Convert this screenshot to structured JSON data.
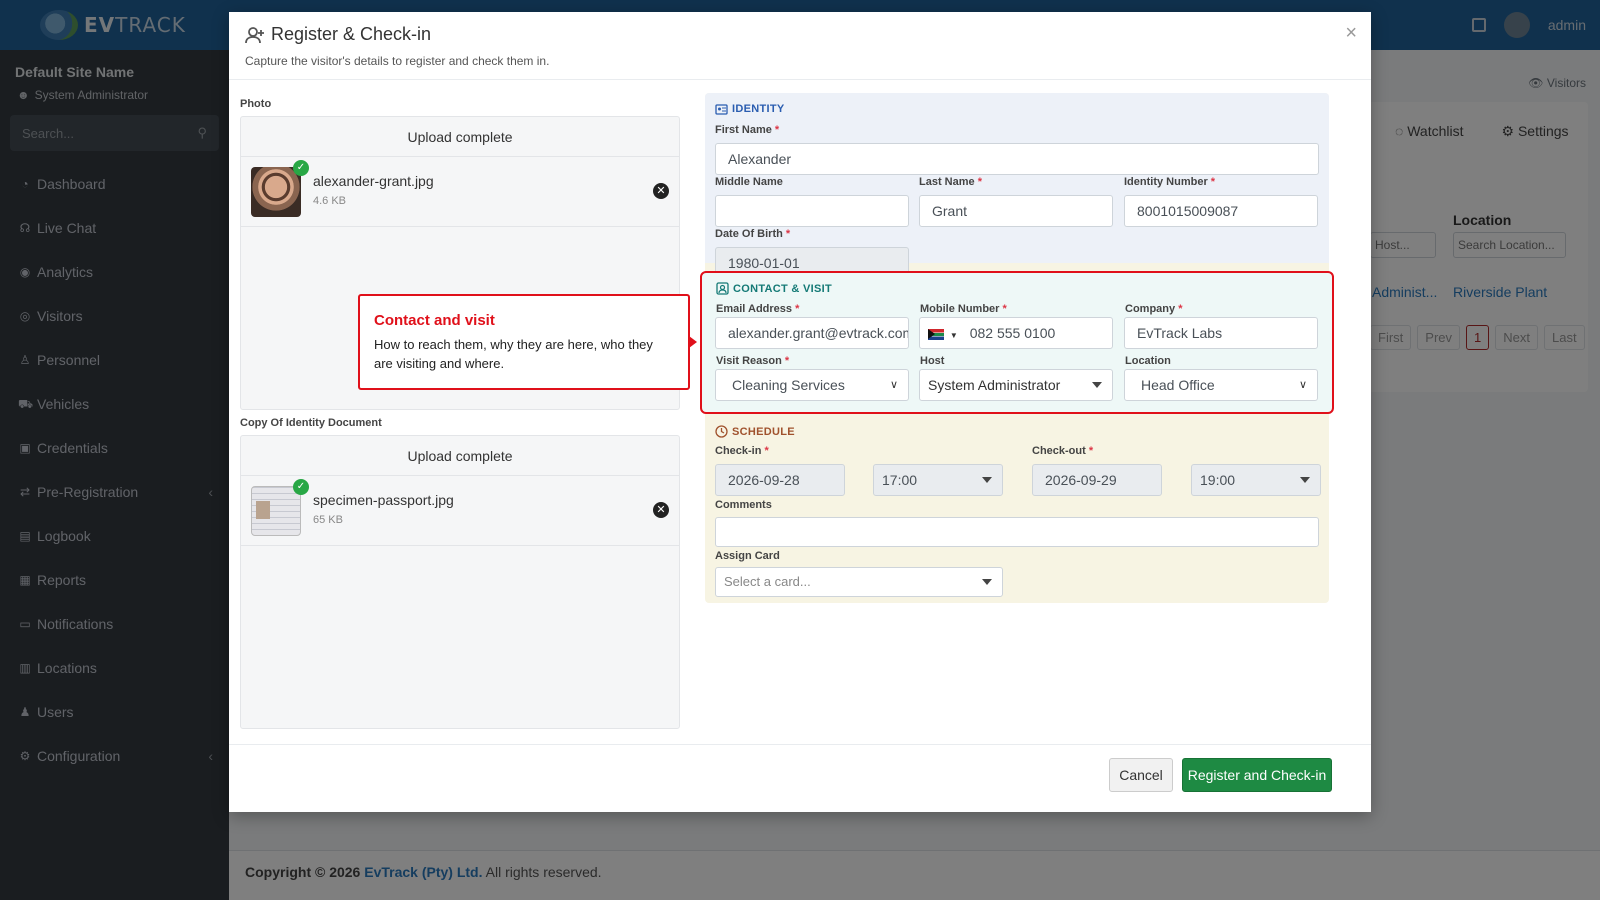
{
  "brand": {
    "name_bold": "EV",
    "name_rest": "TRACK"
  },
  "topbar": {
    "user": "admin"
  },
  "sidebar": {
    "site": "Default Site Name",
    "role": "System Administrator",
    "search_placeholder": "Search...",
    "items": [
      {
        "label": "Dashboard",
        "icon": "dashboard-icon"
      },
      {
        "label": "Live Chat",
        "icon": "headset-icon"
      },
      {
        "label": "Analytics",
        "icon": "analytics-icon"
      },
      {
        "label": "Visitors",
        "icon": "eye-icon"
      },
      {
        "label": "Personnel",
        "icon": "personnel-icon"
      },
      {
        "label": "Vehicles",
        "icon": "car-icon"
      },
      {
        "label": "Credentials",
        "icon": "id-card-icon"
      },
      {
        "label": "Pre-Registration",
        "icon": "exchange-icon",
        "has_submenu": true
      },
      {
        "label": "Logbook",
        "icon": "book-icon"
      },
      {
        "label": "Reports",
        "icon": "reports-icon"
      },
      {
        "label": "Notifications",
        "icon": "bell-icon"
      },
      {
        "label": "Locations",
        "icon": "building-icon"
      },
      {
        "label": "Users",
        "icon": "users-icon"
      },
      {
        "label": "Configuration",
        "icon": "gear-icon",
        "has_submenu": true
      }
    ]
  },
  "background": {
    "breadcrumb": "Visitors",
    "tabs": [
      "Watchlist",
      "Settings"
    ],
    "location_header": "Location",
    "host_placeholder": "Host...",
    "location_placeholder": "Search Location...",
    "row_host": "Administ...",
    "row_location": "Riverside Plant",
    "pager": [
      "First",
      "Prev",
      "1",
      "Next",
      "Last"
    ]
  },
  "footer": {
    "prefix": "Copyright © 2026",
    "company": "EvTrack (Pty) Ltd.",
    "suffix": "All rights reserved."
  },
  "modal": {
    "title": "Register & Check-in",
    "subtitle": "Capture the visitor's details to register and check them in.",
    "close": "×",
    "photo": {
      "label": "Photo",
      "status": "Upload complete",
      "file_name": "alexander-grant.jpg",
      "file_size": "4.6 KB"
    },
    "id_doc": {
      "label": "Copy Of Identity Document",
      "status": "Upload complete",
      "file_name": "specimen-passport.jpg",
      "file_size": "65 KB"
    },
    "identity": {
      "title": "IDENTITY",
      "first_name": {
        "label": "First Name",
        "value": "Alexander"
      },
      "middle_name": {
        "label": "Middle Name",
        "value": ""
      },
      "last_name": {
        "label": "Last Name",
        "value": "Grant"
      },
      "id_number": {
        "label": "Identity Number",
        "value": "8001015009087"
      },
      "dob": {
        "label": "Date Of Birth",
        "value": "1980-01-01"
      }
    },
    "contact": {
      "title": "CONTACT & VISIT",
      "email": {
        "label": "Email Address",
        "value": "alexander.grant@evtrack.com"
      },
      "mobile": {
        "label": "Mobile Number",
        "value": "082 555 0100",
        "flag": "south-africa-flag"
      },
      "company": {
        "label": "Company",
        "value": "EvTrack Labs"
      },
      "visit_reason": {
        "label": "Visit Reason",
        "value": "Cleaning Services"
      },
      "host": {
        "label": "Host",
        "value": "System Administrator"
      },
      "location": {
        "label": "Location",
        "value": "Head Office"
      }
    },
    "schedule": {
      "title": "SCHEDULE",
      "checkin": {
        "label": "Check-in",
        "date": "2026-09-28",
        "time": "17:00"
      },
      "checkout": {
        "label": "Check-out",
        "date": "2026-09-29",
        "time": "19:00"
      },
      "comments": {
        "label": "Comments",
        "value": ""
      },
      "card": {
        "label": "Assign Card",
        "placeholder": "Select a card..."
      }
    },
    "buttons": {
      "cancel": "Cancel",
      "submit": "Register and Check-in"
    }
  },
  "callout": {
    "title": "Contact and visit",
    "body": "How to reach them, why they are here, who they are visiting and where."
  },
  "colors": {
    "primary": "#21639a",
    "accent_red": "#e0101a",
    "success": "#1e8a43",
    "sidebar": "#343a40"
  }
}
